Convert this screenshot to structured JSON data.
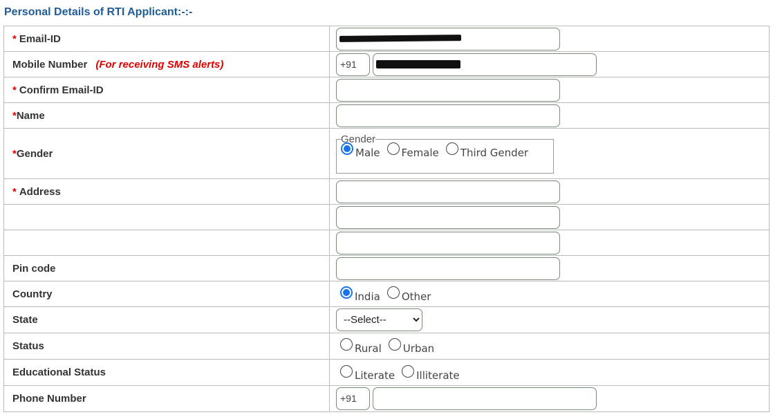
{
  "section_title": "Personal Details of RTI Applicant:-:-",
  "fields": {
    "email": {
      "label": "Email-ID",
      "required_mark": "*"
    },
    "mobile": {
      "label": "Mobile Number",
      "note": "(For receiving SMS alerts)",
      "country_code": "+91"
    },
    "confirm_email": {
      "label": "Confirm Email-ID",
      "required_mark": "*"
    },
    "name": {
      "label": "Name",
      "required_mark": "*"
    },
    "gender": {
      "label": "Gender",
      "required_mark": "*",
      "legend": "Gender",
      "options": [
        "Male",
        "Female",
        "Third Gender"
      ],
      "selected": "Male"
    },
    "address": {
      "label": "Address",
      "required_mark": "*"
    },
    "pincode": {
      "label": "Pin code"
    },
    "country": {
      "label": "Country",
      "options": [
        "India",
        "Other"
      ],
      "selected": "India"
    },
    "state": {
      "label": "State",
      "selected": "--Select--"
    },
    "status": {
      "label": "Status",
      "options": [
        "Rural",
        "Urban"
      ],
      "selected": null
    },
    "education": {
      "label": "Educational Status",
      "options": [
        "Literate",
        "Illiterate"
      ],
      "selected": null
    },
    "phone": {
      "label": "Phone Number",
      "country_code": "+91"
    }
  },
  "colors": {
    "title": "#1f5c99",
    "required": "#dd0000",
    "note": "#e00000",
    "radio_selected": "#1a73e8"
  }
}
